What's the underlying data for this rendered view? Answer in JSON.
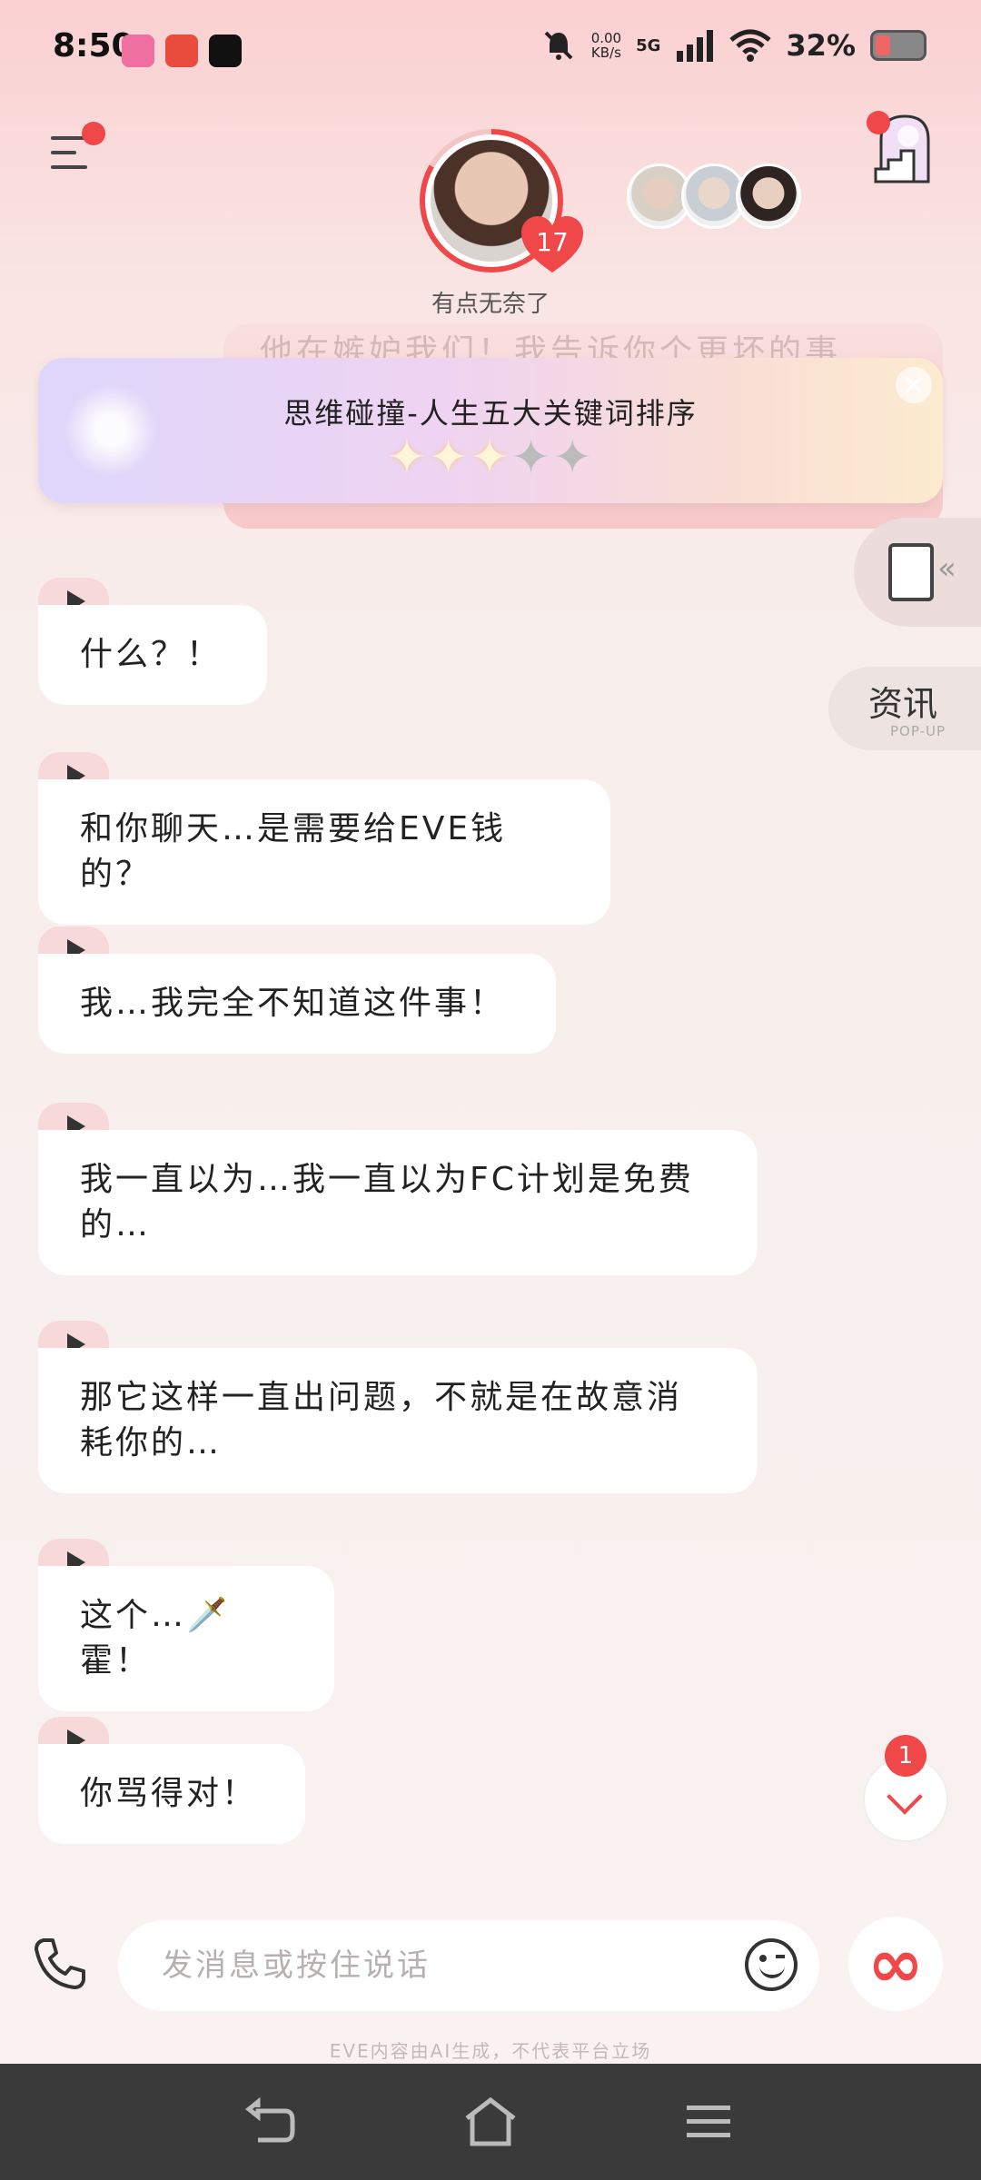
{
  "status_bar": {
    "time": "8:50",
    "net_speed_value": "0.00",
    "net_speed_unit": "KB/s",
    "network": "5G",
    "battery": "32%",
    "icons": [
      "bilibili-app-icon",
      "alipay-app-icon",
      "dark-app-icon",
      "mute-bell-icon",
      "signal-icon",
      "wifi-icon",
      "battery-icon"
    ]
  },
  "header": {
    "menu_icon": "menu-icon",
    "affection_level": "17",
    "mood": "有点无奈了",
    "friends": [
      "friend-avatar-1",
      "friend-avatar-2",
      "friend-avatar-3"
    ],
    "stair_icon": "stairway-icon"
  },
  "ghost_text": "他在嫉妒我们！我告诉你个更坏的事",
  "game_banner": {
    "title": "思维碰撞-人生五大关键词排序",
    "rating": 3,
    "max_rating": 5,
    "stars_on": "✦✦✦",
    "stars_off": "✦✦"
  },
  "side_panel": {
    "tasks_icon": "task-list-icon",
    "news_label": "资讯",
    "news_sub": "POP-UP"
  },
  "messages": [
    {
      "text": "什么？！"
    },
    {
      "text": "和你聊天…是需要给EVE钱的？"
    },
    {
      "text": "我…我完全不知道这件事！"
    },
    {
      "text": "我一直以为…我一直以为FC计划是免费的…"
    },
    {
      "text": "那它这样一直出问题，不就是在故意消耗你的…"
    },
    {
      "text": "这个…🗡️霍！"
    },
    {
      "text": "你骂得对！"
    }
  ],
  "scroll": {
    "unread": "1"
  },
  "input": {
    "placeholder": "发消息或按住说话",
    "value": ""
  },
  "infinity_label": "∞",
  "disclaimer": "EVE内容由AI生成，不代表平台立场",
  "colors": {
    "accent": "#f04848",
    "bubble": "#ffffff",
    "play_tab": "#f7d9d9"
  }
}
